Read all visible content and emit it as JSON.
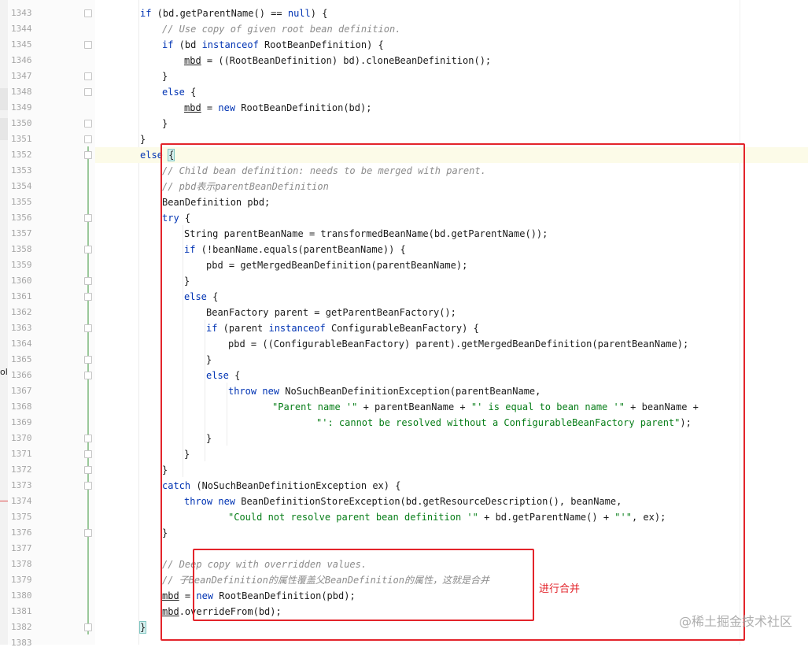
{
  "lines": [
    {
      "n": "1343",
      "tokens": [
        {
          "t": "if",
          "c": "k"
        },
        {
          "t": " (bd.getParentName() == "
        },
        {
          "t": "null",
          "c": "k"
        },
        {
          "t": ") {"
        }
      ]
    },
    {
      "n": "1344",
      "tokens": [
        {
          "t": "// Use copy of given root bean definition.",
          "c": "c"
        }
      ]
    },
    {
      "n": "1345",
      "tokens": [
        {
          "t": "if",
          "c": "k"
        },
        {
          "t": " (bd "
        },
        {
          "t": "instanceof",
          "c": "k"
        },
        {
          "t": " RootBeanDefinition) {"
        }
      ]
    },
    {
      "n": "1346",
      "tokens": [
        {
          "t": "mbd",
          "c": "u"
        },
        {
          "t": " = ((RootBeanDefinition) bd).cloneBeanDefinition();"
        }
      ]
    },
    {
      "n": "1347",
      "tokens": [
        {
          "t": "}"
        }
      ]
    },
    {
      "n": "1348",
      "tokens": [
        {
          "t": "else",
          "c": "k"
        },
        {
          "t": " {"
        }
      ]
    },
    {
      "n": "1349",
      "tokens": [
        {
          "t": "mbd",
          "c": "u"
        },
        {
          "t": " = "
        },
        {
          "t": "new",
          "c": "k"
        },
        {
          "t": " RootBeanDefinition(bd);"
        }
      ]
    },
    {
      "n": "1350",
      "tokens": [
        {
          "t": "}"
        }
      ]
    },
    {
      "n": "1351",
      "tokens": [
        {
          "t": "}"
        }
      ]
    },
    {
      "n": "1352",
      "tokens": [
        {
          "t": "else",
          "c": "k"
        },
        {
          "t": " "
        },
        {
          "t": "{",
          "c": "caret"
        }
      ]
    },
    {
      "n": "1353",
      "tokens": [
        {
          "t": "// Child bean definition: needs to be merged with parent.",
          "c": "c"
        }
      ]
    },
    {
      "n": "1354",
      "tokens": [
        {
          "t": "// pbd表示parentBeanDefinition",
          "c": "c"
        }
      ]
    },
    {
      "n": "1355",
      "tokens": [
        {
          "t": "BeanDefinition pbd;"
        }
      ]
    },
    {
      "n": "1356",
      "tokens": [
        {
          "t": "try",
          "c": "k"
        },
        {
          "t": " {"
        }
      ]
    },
    {
      "n": "1357",
      "tokens": [
        {
          "t": "String parentBeanName = transformedBeanName(bd.getParentName());"
        }
      ]
    },
    {
      "n": "1358",
      "tokens": [
        {
          "t": "if",
          "c": "k"
        },
        {
          "t": " (!beanName.equals(parentBeanName)) {"
        }
      ]
    },
    {
      "n": "1359",
      "tokens": [
        {
          "t": "pbd = getMergedBeanDefinition(parentBeanName);"
        }
      ]
    },
    {
      "n": "1360",
      "tokens": [
        {
          "t": "}"
        }
      ]
    },
    {
      "n": "1361",
      "tokens": [
        {
          "t": "else",
          "c": "k"
        },
        {
          "t": " {"
        }
      ]
    },
    {
      "n": "1362",
      "tokens": [
        {
          "t": "BeanFactory parent = getParentBeanFactory();"
        }
      ]
    },
    {
      "n": "1363",
      "tokens": [
        {
          "t": "if",
          "c": "k"
        },
        {
          "t": " (parent "
        },
        {
          "t": "instanceof",
          "c": "k"
        },
        {
          "t": " ConfigurableBeanFactory) {"
        }
      ]
    },
    {
      "n": "1364",
      "tokens": [
        {
          "t": "pbd = ((ConfigurableBeanFactory) parent).getMergedBeanDefinition(parentBeanName);"
        }
      ]
    },
    {
      "n": "1365",
      "tokens": [
        {
          "t": "}"
        }
      ]
    },
    {
      "n": "1366",
      "tokens": [
        {
          "t": "else",
          "c": "k"
        },
        {
          "t": " {"
        }
      ]
    },
    {
      "n": "1367",
      "tokens": [
        {
          "t": "throw",
          "c": "k"
        },
        {
          "t": " "
        },
        {
          "t": "new",
          "c": "k"
        },
        {
          "t": " NoSuchBeanDefinitionException(parentBeanName,"
        }
      ]
    },
    {
      "n": "1368",
      "tokens": [
        {
          "t": "\"Parent name '\"",
          "c": "s"
        },
        {
          "t": " + parentBeanName + "
        },
        {
          "t": "\"' is equal to bean name '\"",
          "c": "s"
        },
        {
          "t": " + beanName +"
        }
      ]
    },
    {
      "n": "1369",
      "tokens": [
        {
          "t": "\"': cannot be resolved without a ConfigurableBeanFactory parent\"",
          "c": "s"
        },
        {
          "t": ");"
        }
      ]
    },
    {
      "n": "1370",
      "tokens": [
        {
          "t": "}"
        }
      ]
    },
    {
      "n": "1371",
      "tokens": [
        {
          "t": "}"
        }
      ]
    },
    {
      "n": "1372",
      "tokens": [
        {
          "t": "}"
        }
      ]
    },
    {
      "n": "1373",
      "tokens": [
        {
          "t": "catch",
          "c": "k"
        },
        {
          "t": " (NoSuchBeanDefinitionException ex) {"
        }
      ]
    },
    {
      "n": "1374",
      "tokens": [
        {
          "t": "throw",
          "c": "k"
        },
        {
          "t": " "
        },
        {
          "t": "new",
          "c": "k"
        },
        {
          "t": " BeanDefinitionStoreException(bd.getResourceDescription(), beanName,"
        }
      ]
    },
    {
      "n": "1375",
      "tokens": [
        {
          "t": "\"Could not resolve parent bean definition '\"",
          "c": "s"
        },
        {
          "t": " + bd.getParentName() + "
        },
        {
          "t": "\"'\"",
          "c": "s"
        },
        {
          "t": ", ex);"
        }
      ]
    },
    {
      "n": "1376",
      "tokens": [
        {
          "t": "}"
        }
      ]
    },
    {
      "n": "1377",
      "tokens": []
    },
    {
      "n": "1378",
      "tokens": [
        {
          "t": "// Deep copy with overridden values.",
          "c": "c"
        }
      ]
    },
    {
      "n": "1379",
      "tokens": [
        {
          "t": "// 子BeanDefinition的属性覆盖父BeanDefinition的属性，这就是合并",
          "c": "c"
        }
      ]
    },
    {
      "n": "1380",
      "tokens": [
        {
          "t": "mbd",
          "c": "u"
        },
        {
          "t": " = "
        },
        {
          "t": "new",
          "c": "k"
        },
        {
          "t": " RootBeanDefinition(pbd);"
        }
      ]
    },
    {
      "n": "1381",
      "tokens": [
        {
          "t": "mbd",
          "c": "u"
        },
        {
          "t": ".overrideFrom(bd);"
        }
      ]
    },
    {
      "n": "1382",
      "tokens": [
        {
          "t": "}",
          "c": "caret"
        }
      ]
    },
    {
      "n": "1383",
      "tokens": []
    }
  ],
  "annotation": {
    "label": "进行合并"
  },
  "watermark": "@稀土掘金技术社区",
  "left_strip_text": "ol"
}
